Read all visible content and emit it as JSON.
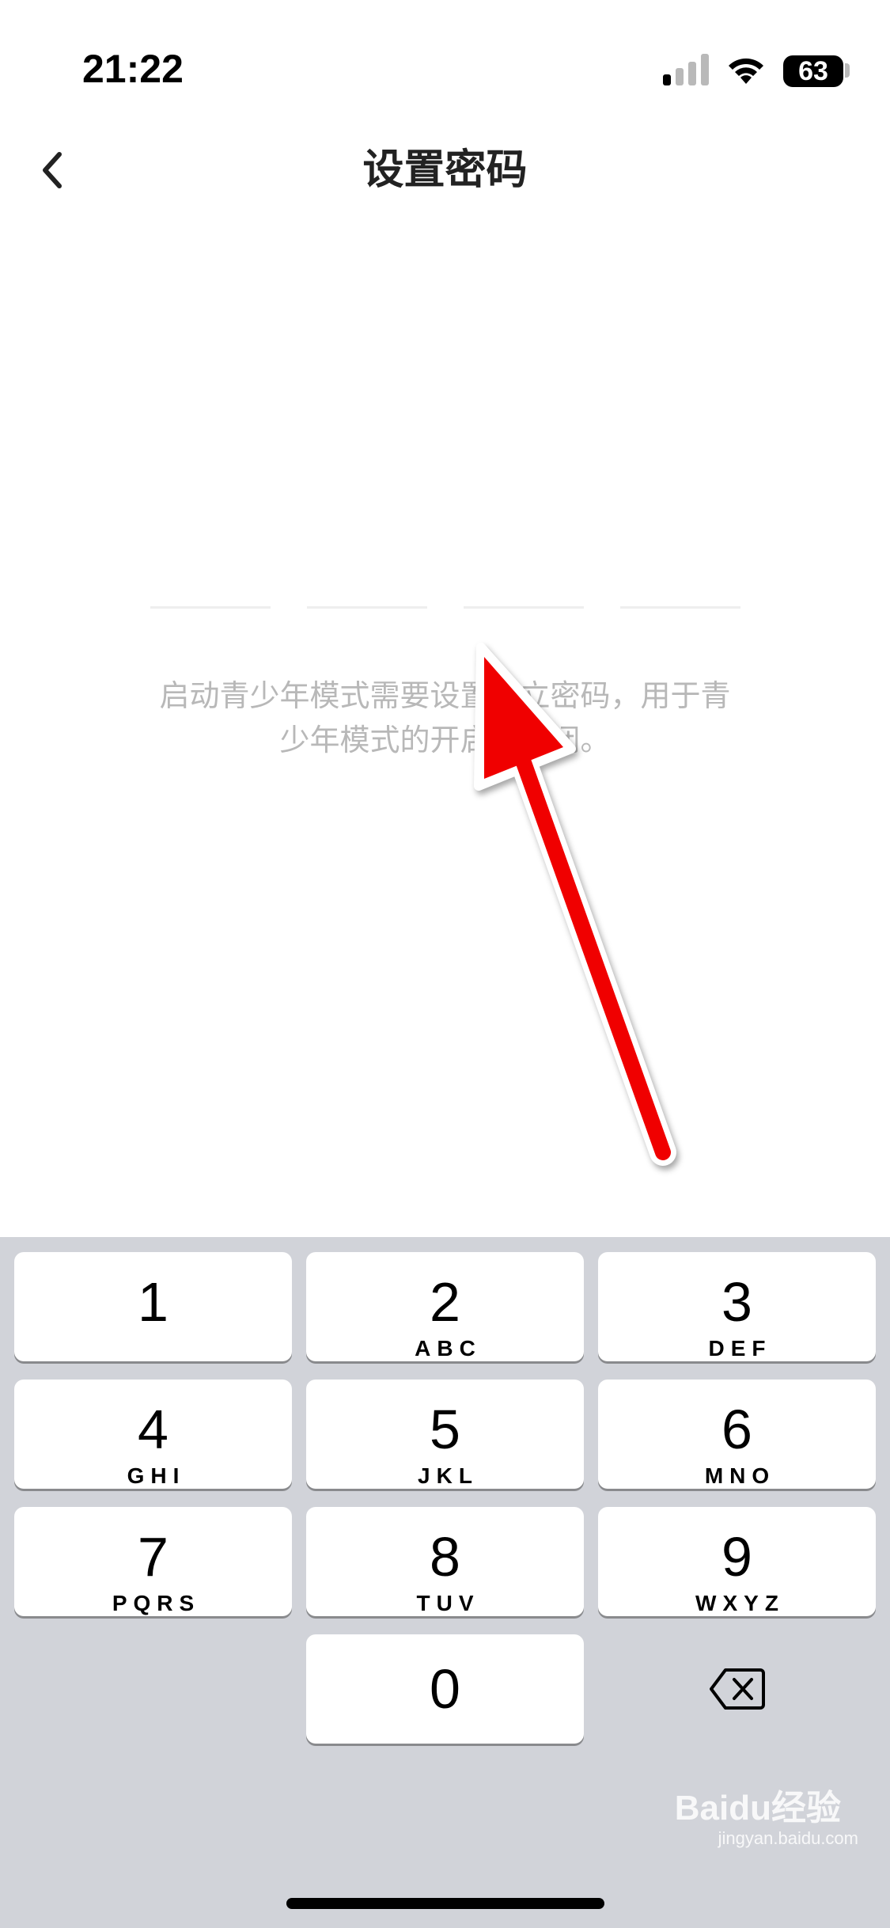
{
  "status_bar": {
    "time": "21:22",
    "battery": "63"
  },
  "nav": {
    "title": "设置密码"
  },
  "pin": {
    "slot_count": 4,
    "hint": "启动青少年模式需要设置独立密码，用于青少年模式的开启与关闭。"
  },
  "keypad": {
    "keys": [
      {
        "digit": "1",
        "letters": ""
      },
      {
        "digit": "2",
        "letters": "ABC"
      },
      {
        "digit": "3",
        "letters": "DEF"
      },
      {
        "digit": "4",
        "letters": "GHI"
      },
      {
        "digit": "5",
        "letters": "JKL"
      },
      {
        "digit": "6",
        "letters": "MNO"
      },
      {
        "digit": "7",
        "letters": "PQRS"
      },
      {
        "digit": "8",
        "letters": "TUV"
      },
      {
        "digit": "9",
        "letters": "WXYZ"
      },
      {
        "digit": "0",
        "letters": ""
      }
    ]
  },
  "watermark": {
    "brand": "Baidu经验",
    "url": "jingyan.baidu.com"
  },
  "colors": {
    "keypad_bg": "#d1d3d9",
    "arrow": "#f00000",
    "hint": "#b8b8b8"
  }
}
